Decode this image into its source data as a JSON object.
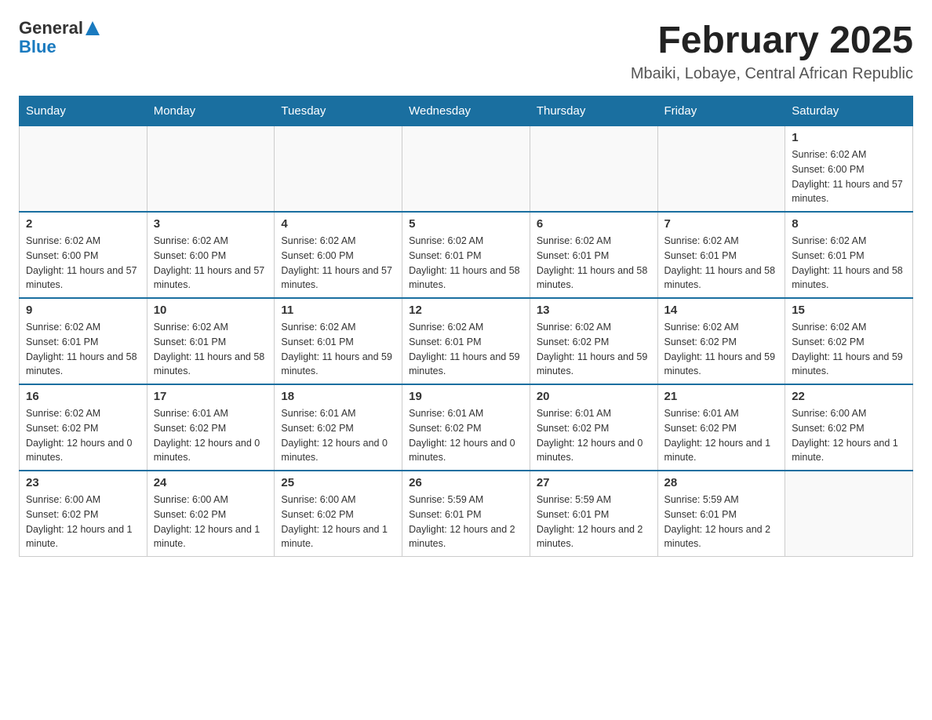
{
  "header": {
    "logo_general": "General",
    "logo_blue": "Blue",
    "title": "February 2025",
    "subtitle": "Mbaiki, Lobaye, Central African Republic"
  },
  "weekdays": [
    "Sunday",
    "Monday",
    "Tuesday",
    "Wednesday",
    "Thursday",
    "Friday",
    "Saturday"
  ],
  "weeks": [
    [
      {
        "day": "",
        "info": ""
      },
      {
        "day": "",
        "info": ""
      },
      {
        "day": "",
        "info": ""
      },
      {
        "day": "",
        "info": ""
      },
      {
        "day": "",
        "info": ""
      },
      {
        "day": "",
        "info": ""
      },
      {
        "day": "1",
        "info": "Sunrise: 6:02 AM\nSunset: 6:00 PM\nDaylight: 11 hours and 57 minutes."
      }
    ],
    [
      {
        "day": "2",
        "info": "Sunrise: 6:02 AM\nSunset: 6:00 PM\nDaylight: 11 hours and 57 minutes."
      },
      {
        "day": "3",
        "info": "Sunrise: 6:02 AM\nSunset: 6:00 PM\nDaylight: 11 hours and 57 minutes."
      },
      {
        "day": "4",
        "info": "Sunrise: 6:02 AM\nSunset: 6:00 PM\nDaylight: 11 hours and 57 minutes."
      },
      {
        "day": "5",
        "info": "Sunrise: 6:02 AM\nSunset: 6:01 PM\nDaylight: 11 hours and 58 minutes."
      },
      {
        "day": "6",
        "info": "Sunrise: 6:02 AM\nSunset: 6:01 PM\nDaylight: 11 hours and 58 minutes."
      },
      {
        "day": "7",
        "info": "Sunrise: 6:02 AM\nSunset: 6:01 PM\nDaylight: 11 hours and 58 minutes."
      },
      {
        "day": "8",
        "info": "Sunrise: 6:02 AM\nSunset: 6:01 PM\nDaylight: 11 hours and 58 minutes."
      }
    ],
    [
      {
        "day": "9",
        "info": "Sunrise: 6:02 AM\nSunset: 6:01 PM\nDaylight: 11 hours and 58 minutes."
      },
      {
        "day": "10",
        "info": "Sunrise: 6:02 AM\nSunset: 6:01 PM\nDaylight: 11 hours and 58 minutes."
      },
      {
        "day": "11",
        "info": "Sunrise: 6:02 AM\nSunset: 6:01 PM\nDaylight: 11 hours and 59 minutes."
      },
      {
        "day": "12",
        "info": "Sunrise: 6:02 AM\nSunset: 6:01 PM\nDaylight: 11 hours and 59 minutes."
      },
      {
        "day": "13",
        "info": "Sunrise: 6:02 AM\nSunset: 6:02 PM\nDaylight: 11 hours and 59 minutes."
      },
      {
        "day": "14",
        "info": "Sunrise: 6:02 AM\nSunset: 6:02 PM\nDaylight: 11 hours and 59 minutes."
      },
      {
        "day": "15",
        "info": "Sunrise: 6:02 AM\nSunset: 6:02 PM\nDaylight: 11 hours and 59 minutes."
      }
    ],
    [
      {
        "day": "16",
        "info": "Sunrise: 6:02 AM\nSunset: 6:02 PM\nDaylight: 12 hours and 0 minutes."
      },
      {
        "day": "17",
        "info": "Sunrise: 6:01 AM\nSunset: 6:02 PM\nDaylight: 12 hours and 0 minutes."
      },
      {
        "day": "18",
        "info": "Sunrise: 6:01 AM\nSunset: 6:02 PM\nDaylight: 12 hours and 0 minutes."
      },
      {
        "day": "19",
        "info": "Sunrise: 6:01 AM\nSunset: 6:02 PM\nDaylight: 12 hours and 0 minutes."
      },
      {
        "day": "20",
        "info": "Sunrise: 6:01 AM\nSunset: 6:02 PM\nDaylight: 12 hours and 0 minutes."
      },
      {
        "day": "21",
        "info": "Sunrise: 6:01 AM\nSunset: 6:02 PM\nDaylight: 12 hours and 1 minute."
      },
      {
        "day": "22",
        "info": "Sunrise: 6:00 AM\nSunset: 6:02 PM\nDaylight: 12 hours and 1 minute."
      }
    ],
    [
      {
        "day": "23",
        "info": "Sunrise: 6:00 AM\nSunset: 6:02 PM\nDaylight: 12 hours and 1 minute."
      },
      {
        "day": "24",
        "info": "Sunrise: 6:00 AM\nSunset: 6:02 PM\nDaylight: 12 hours and 1 minute."
      },
      {
        "day": "25",
        "info": "Sunrise: 6:00 AM\nSunset: 6:02 PM\nDaylight: 12 hours and 1 minute."
      },
      {
        "day": "26",
        "info": "Sunrise: 5:59 AM\nSunset: 6:01 PM\nDaylight: 12 hours and 2 minutes."
      },
      {
        "day": "27",
        "info": "Sunrise: 5:59 AM\nSunset: 6:01 PM\nDaylight: 12 hours and 2 minutes."
      },
      {
        "day": "28",
        "info": "Sunrise: 5:59 AM\nSunset: 6:01 PM\nDaylight: 12 hours and 2 minutes."
      },
      {
        "day": "",
        "info": ""
      }
    ]
  ]
}
